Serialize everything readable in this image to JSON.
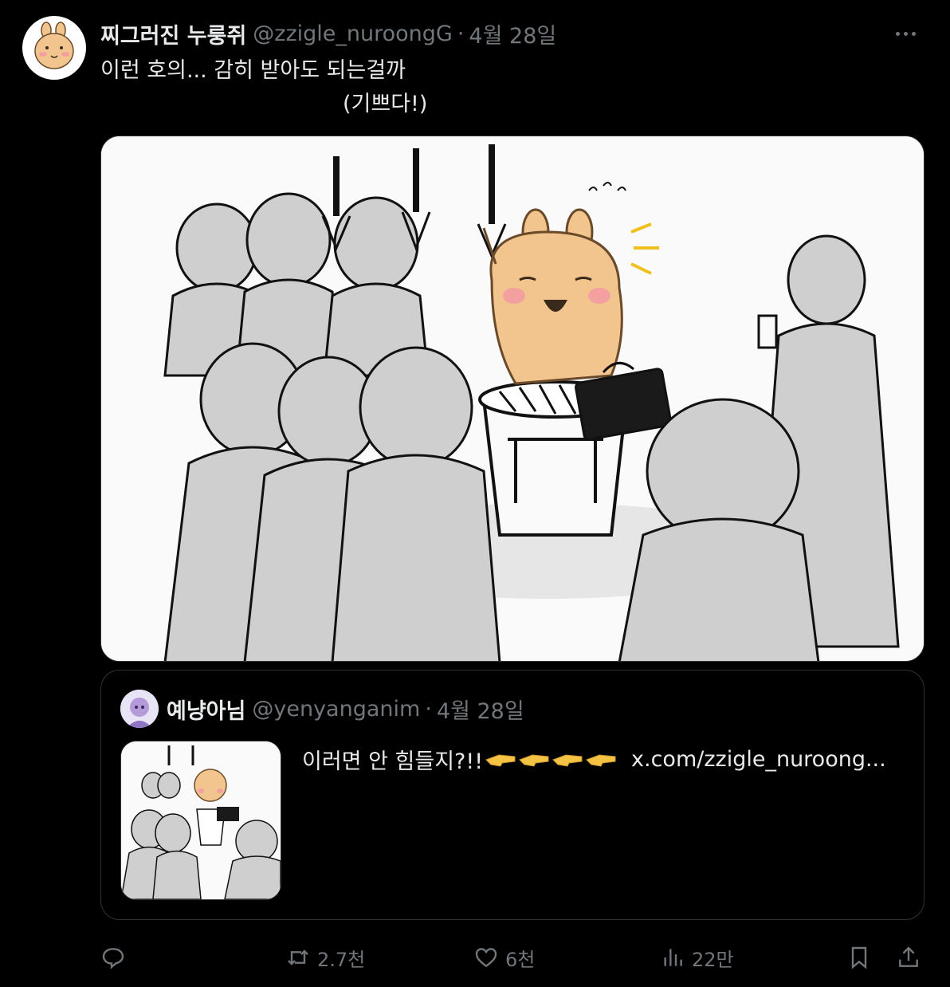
{
  "tweet": {
    "display_name": "찌그러진 누룽쥐",
    "handle": "@zzigle_nuroongG",
    "separator": "·",
    "date": "4월 28일",
    "text_line1": "이런 호의... 감히 받아도 되는걸까",
    "text_line2": "(기쁘다!)"
  },
  "quote": {
    "display_name": "예냥아님",
    "handle": "@yenyanganim",
    "separator": "·",
    "date": "4월 28일",
    "text": "이러면 안 힘들지?!!",
    "emoji_names": [
      "backhand-index-pointing-left",
      "backhand-index-pointing-left",
      "backhand-index-pointing-left",
      "backhand-index-pointing-left"
    ],
    "link": "x.com/zzigle_nuroong..."
  },
  "actions": {
    "reply_count": "",
    "retweet_count": "2.7천",
    "like_count": "6천",
    "view_count": "22만"
  },
  "colors": {
    "background": "#000000",
    "primary_text": "#e7e9ea",
    "secondary_text": "#71767b",
    "border": "#2f3336"
  }
}
